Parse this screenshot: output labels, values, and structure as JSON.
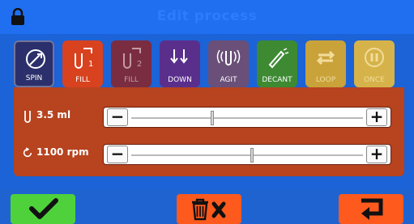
{
  "header": {
    "title": "Edit process",
    "lock_icon": "lock-icon"
  },
  "tabs": [
    {
      "label": "SPIN",
      "icon": "spin-icon",
      "color": "#2b2f6b",
      "active": false
    },
    {
      "label": "FILL",
      "icon": "fill-1-icon",
      "badge": "1",
      "color": "#d8421f",
      "active": true
    },
    {
      "label": "FILL",
      "icon": "fill-2-icon",
      "badge": "2",
      "color": "#7a2d40",
      "active": false
    },
    {
      "label": "DOWN",
      "icon": "down-icon",
      "color": "#5a2f8c",
      "active": false
    },
    {
      "label": "AGIT",
      "icon": "agitate-icon",
      "color": "#6a5078",
      "active": false
    },
    {
      "label": "DECANT",
      "icon": "decant-icon",
      "color": "#3d8a33",
      "active": false
    },
    {
      "label": "LOOP",
      "icon": "loop-icon",
      "color": "#caa23a",
      "active": false
    },
    {
      "label": "ONCE",
      "icon": "once-icon",
      "color": "#d6b34a",
      "active": false
    }
  ],
  "settings": [
    {
      "icon": "tube-icon",
      "label": "3.5 ml",
      "level": 0.35
    },
    {
      "icon": "rotation-icon",
      "label": "1100 rpm",
      "level": 0.52
    }
  ],
  "controls": {
    "decrement": "−",
    "increment": "+"
  },
  "bottom": {
    "confirm_icon": "checkmark-icon",
    "delete_icon": "trash-x-icon",
    "back_icon": "return-arrow-icon",
    "colors": {
      "confirm": "#4fd13c",
      "delete": "#ff5a1e",
      "back": "#ff5a1e"
    }
  }
}
